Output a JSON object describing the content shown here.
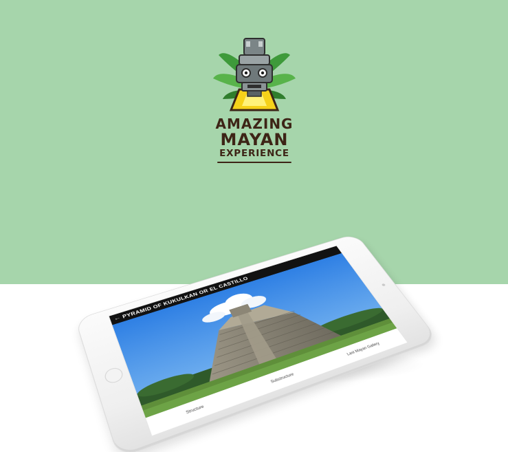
{
  "brand": {
    "line1": "AMAZING",
    "line2": "MAYAN",
    "line3": "EXPERIENCE"
  },
  "app": {
    "back_icon": "back-arrow-icon",
    "title": "PYRAMID OF KUKULKAN OR EL CASTILLO",
    "tabs": [
      {
        "label": "Structure"
      },
      {
        "label": "Substructure"
      },
      {
        "label": "Last Mayan Gallery"
      }
    ]
  },
  "colors": {
    "background_top": "#a6d5ab",
    "background_bottom": "#ffffff",
    "logo_text": "#3d2416",
    "app_header": "#121212",
    "sky": "#3f8fe8"
  }
}
